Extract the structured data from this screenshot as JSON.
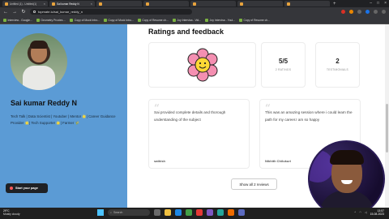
{
  "browser": {
    "tabs": [
      {
        "label": "Untitled (1) - Untitled(1)",
        "active": false
      },
      {
        "label": "Sai kumar Reddy N",
        "active": true
      },
      {
        "label": "",
        "active": false
      },
      {
        "label": "",
        "active": false
      },
      {
        "label": "",
        "active": false
      },
      {
        "label": "",
        "active": false
      },
      {
        "label": "",
        "active": false
      }
    ],
    "url": "topmate.io/sai_kumar_reddy_n",
    "bookmarks": [
      "Interview - Google...",
      "Geometry Proxies ...",
      "Copy of Mock Intro...",
      "Copy of Mock Intro...",
      "Copy of Resume ch...",
      "Joy Intervisa - Vid...",
      "Joy Intervisa - Youl...",
      "Copy of Resume ch..."
    ]
  },
  "profile": {
    "name": "Sai kumar Reddy N",
    "bio": "Tech Talk | Data Scientist | Youtuber | Mentor 🌟| Career Guidance Provider 🌟| Tech Supporter 🌟| Farmer 🌾",
    "start_button": "Start your page"
  },
  "ratings": {
    "section_title": "Ratings and feedback",
    "score": "5/5",
    "score_label": "2 RATINGS",
    "testimonials": "2",
    "testimonials_label": "TESTIMONIALS",
    "reviews": [
      {
        "text": "Sai provided complete details and thorough understanding of the subject",
        "author": "sathish"
      },
      {
        "text": "This was an amazing session where i could learn the path for my career.I am so happy",
        "author": "Nikhith Chilukuri"
      }
    ],
    "show_all": "Show all 2 reviews"
  },
  "taskbar": {
    "temperature": "29°C",
    "weather": "Mostly cloudy",
    "search_placeholder": "Search",
    "time": "13:57",
    "date": "15-08-2023"
  }
}
